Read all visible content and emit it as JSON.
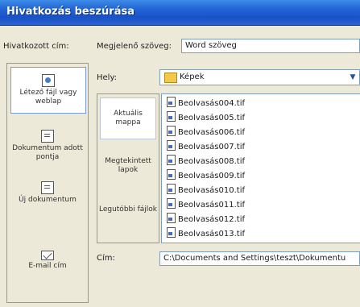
{
  "window": {
    "title": "Hivatkozás beszúrása"
  },
  "labels": {
    "linked_address": "Hivatkozott cím:",
    "display_text": "Megjelenő szöveg:",
    "location": "Hely:",
    "address": "Cím:"
  },
  "fields": {
    "display_text_value": "Word szöveg",
    "location_value": "Képek",
    "address_value": "C:\\Documents and Settings\\teszt\\Dokumentu"
  },
  "sidebar": {
    "items": [
      {
        "label": "Létező fájl vagy weblap",
        "icon": "globe-icon",
        "selected": true
      },
      {
        "label": "Dokumentum adott pontja",
        "icon": "document-bookmark-icon",
        "selected": false
      },
      {
        "label": "Új dokumentum",
        "icon": "new-document-icon",
        "selected": false
      },
      {
        "label": "E-mail cím",
        "icon": "email-icon",
        "selected": false
      }
    ]
  },
  "places": [
    {
      "label": "Aktuális mappa",
      "selected": true
    },
    {
      "label": "Megtekintett lapok",
      "selected": false
    },
    {
      "label": "Legutóbbi fájlok",
      "selected": false
    }
  ],
  "files": [
    "Beolvasás004.tif",
    "Beolvasás005.tif",
    "Beolvasás006.tif",
    "Beolvasás007.tif",
    "Beolvasás008.tif",
    "Beolvasás009.tif",
    "Beolvasás010.tif",
    "Beolvasás011.tif",
    "Beolvasás012.tif",
    "Beolvasás013.tif"
  ],
  "colors": {
    "titlebar": "#2265d6",
    "dialog_bg": "#ECE9D8",
    "field_border": "#7f9db9"
  }
}
